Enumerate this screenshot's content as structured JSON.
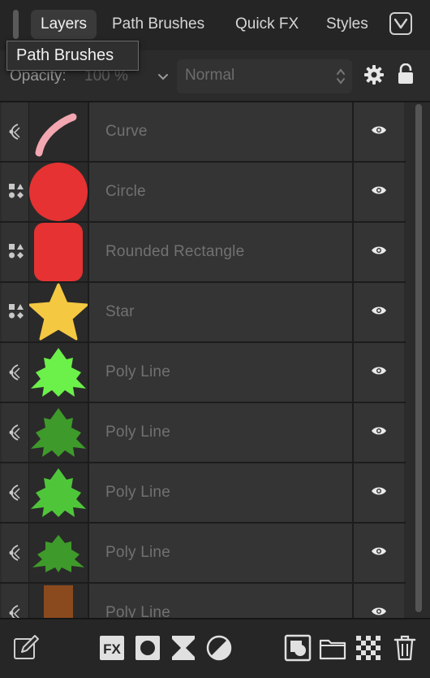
{
  "tabs": [
    {
      "label": "Layers",
      "active": true
    },
    {
      "label": "Path Brushes",
      "active": false
    },
    {
      "label": "Quick FX",
      "active": false
    },
    {
      "label": "Styles",
      "active": false
    }
  ],
  "tabs_more_icon": "chevron-down-icon",
  "tooltip": "Path Brushes",
  "opacity": {
    "label": "Opacity:",
    "value": "100 %"
  },
  "blend_mode": {
    "value": "Normal"
  },
  "layers": [
    {
      "name": "Curve",
      "type_icon": "curve-icon",
      "thumb": "pink-curve",
      "visible": true
    },
    {
      "name": "Circle",
      "type_icon": "shape-icon",
      "thumb": "red-circle",
      "visible": true
    },
    {
      "name": "Rounded Rectangle",
      "type_icon": "shape-icon",
      "thumb": "red-rounded-rect",
      "visible": true
    },
    {
      "name": "Star",
      "type_icon": "shape-icon",
      "thumb": "yellow-star",
      "visible": true
    },
    {
      "name": "Poly Line",
      "type_icon": "curve-icon",
      "thumb": "light-green-tree",
      "visible": true
    },
    {
      "name": "Poly Line",
      "type_icon": "curve-icon",
      "thumb": "dark-green-tree",
      "visible": true
    },
    {
      "name": "Poly Line",
      "type_icon": "curve-icon",
      "thumb": "green-tree",
      "visible": true
    },
    {
      "name": "Poly Line",
      "type_icon": "curve-icon",
      "thumb": "dark-green-tree-small",
      "visible": true
    },
    {
      "name": "Poly Line",
      "type_icon": "curve-icon",
      "thumb": "brown-rect",
      "visible": true
    }
  ],
  "bottom_toolbar": [
    "edit-icon",
    "fx-icon",
    "mask-icon",
    "adjustment-icon",
    "live-filter-icon",
    "add-pixel-layer-icon",
    "group-folder-icon",
    "transparency-icon",
    "trash-icon"
  ],
  "colors": {
    "accent_red": "#e63232",
    "pink": "#f2a7b1",
    "star_yellow": "#f5c842",
    "light_green": "#6cf04a",
    "dark_green": "#3e9a2a",
    "green": "#4fc63a",
    "brown": "#8b4a1e"
  }
}
